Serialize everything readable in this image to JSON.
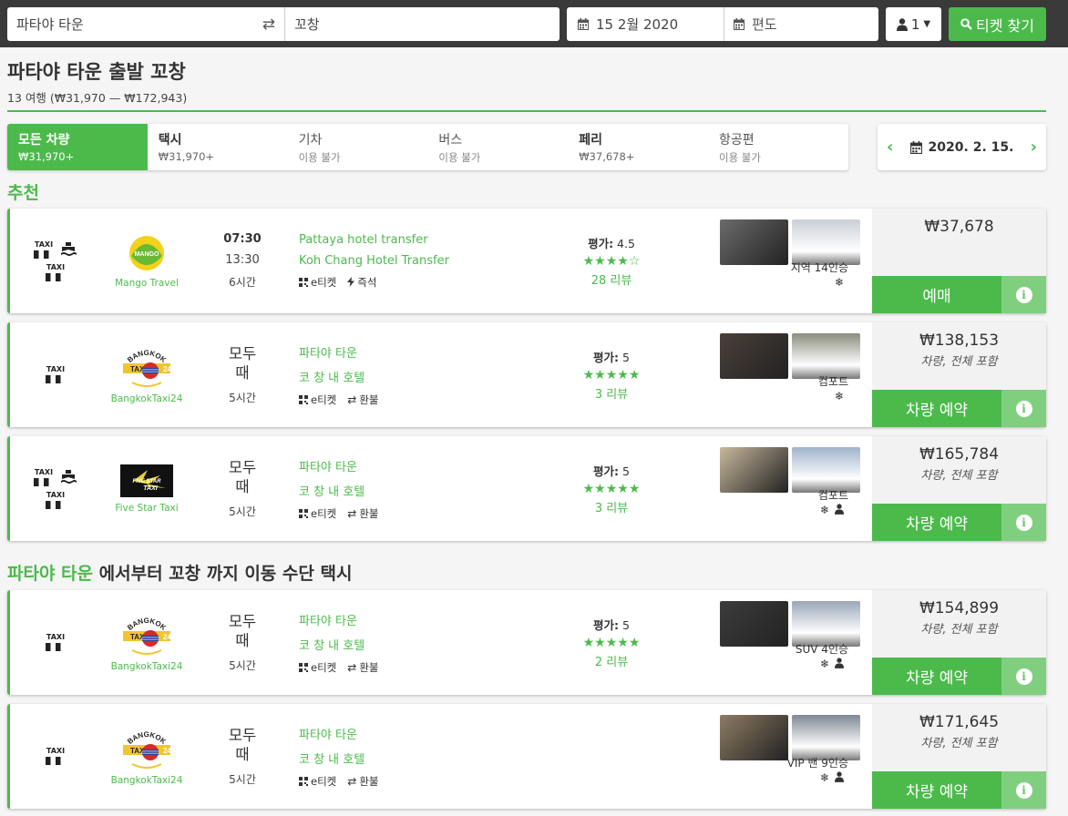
{
  "search": {
    "from": "파타야 타운",
    "to": "꼬창",
    "date": "15 2월 2020",
    "return_placeholder": "편도",
    "pax": "1",
    "search_label": "티켓 찾기"
  },
  "header": {
    "title": "파타야 타운 출발 꼬창",
    "subtitle": "13 여행 (₩31,970 — ₩172,943)"
  },
  "tabs": [
    {
      "label": "모든 차량",
      "sub": "₩31,970+",
      "active": true
    },
    {
      "label": "택시",
      "sub": "₩31,970+"
    },
    {
      "label": "기차",
      "sub": "이용 불가"
    },
    {
      "label": "버스",
      "sub": "이용 불가"
    },
    {
      "label": "페리",
      "sub": "₩37,678+"
    },
    {
      "label": "항공편",
      "sub": "이용 불가"
    }
  ],
  "date_picker": {
    "date": "2020. 2. 15."
  },
  "section1": {
    "title": "추천"
  },
  "section2": {
    "highlight": "파타야 타운",
    "rest": " 에서부터 꼬창 까지 이동 수단 택시"
  },
  "common": {
    "taxi_label": "TAXI",
    "eticket": "e티켓",
    "instant": "즉석",
    "refund": "환불",
    "rating_label": "평가:",
    "any_time_1": "모두",
    "any_time_2": "때",
    "info": "i"
  },
  "cards": [
    {
      "company": "Mango Travel",
      "logo_text": "MANGO",
      "dep": "07:30",
      "arr": "13:30",
      "duration": "6시간",
      "route1": "Pattaya hotel transfer",
      "route2": "Koh Chang Hotel Transfer",
      "rating": "4.5",
      "stars": "★★★★☆",
      "reviews": "28 리뷰",
      "vehicle": "지역 14인승",
      "price": "₩37,678",
      "note": "",
      "book": "예매"
    },
    {
      "company": "BangkokTaxi24",
      "logo_text": "BANGKOK",
      "logo_sub": "TAXI",
      "logo_num": "24",
      "dep": "",
      "arr": "",
      "duration": "5시간",
      "route1": "파타야 타운",
      "route2": "코 창 내 호텔",
      "rating": "5",
      "stars": "★★★★★",
      "reviews": "3 리뷰",
      "vehicle": "컴포트",
      "price": "₩138,153",
      "note": "차량, 전체 포함",
      "book": "차량 예약"
    },
    {
      "company": "Five Star Taxi",
      "logo_text": "FIVE STAR",
      "logo_sub": "TAXI",
      "dep": "",
      "arr": "",
      "duration": "5시간",
      "route1": "파타야 타운",
      "route2": "코 창 내 호텔",
      "rating": "5",
      "stars": "★★★★★",
      "reviews": "3 리뷰",
      "vehicle": "컴포트",
      "price": "₩165,784",
      "note": "차량, 전체 포함",
      "book": "차량 예약"
    },
    {
      "company": "BangkokTaxi24",
      "logo_text": "BANGKOK",
      "logo_sub": "TAXI",
      "logo_num": "24",
      "dep": "",
      "arr": "",
      "duration": "5시간",
      "route1": "파타야 타운",
      "route2": "코 창 내 호텔",
      "rating": "5",
      "stars": "★★★★★",
      "reviews": "2 리뷰",
      "vehicle": "SUV 4인승",
      "price": "₩154,899",
      "note": "차량, 전체 포함",
      "book": "차량 예약"
    },
    {
      "company": "BangkokTaxi24",
      "logo_text": "BANGKOK",
      "logo_sub": "TAXI",
      "logo_num": "24",
      "dep": "",
      "arr": "",
      "duration": "5시간",
      "route1": "파타야 타운",
      "route2": "코 창 내 호텔",
      "rating": "",
      "stars": "",
      "reviews": "",
      "vehicle": "VIP 밴 9인승",
      "price": "₩171,645",
      "note": "차량, 전체 포함",
      "book": "차량 예약"
    }
  ]
}
